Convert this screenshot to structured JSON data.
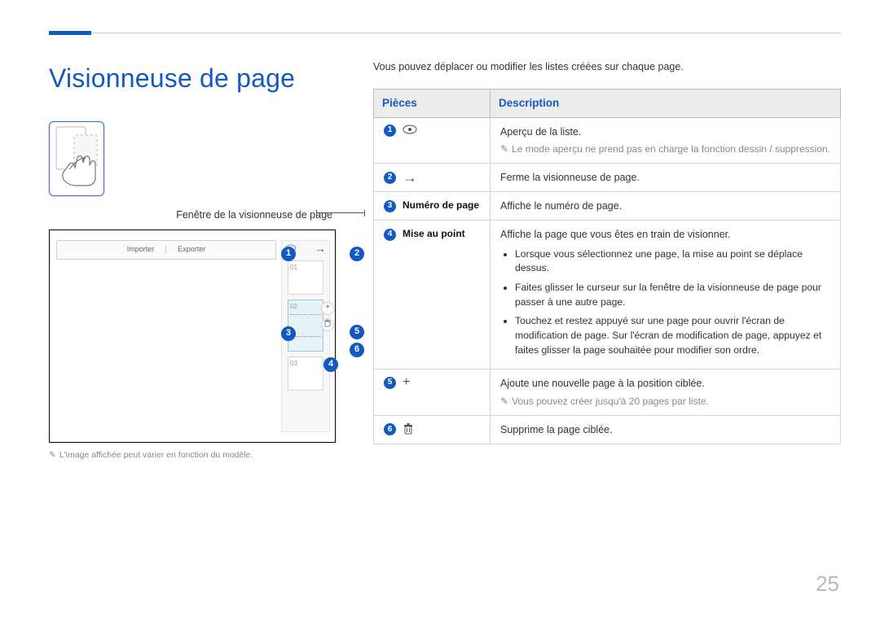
{
  "title": "Visionneuse de page",
  "caption_viewer": "Fenêtre de la visionneuse de page",
  "viewer_toolbar": {
    "import": "Importer",
    "export": "Exporter"
  },
  "viewer_pages": [
    "01",
    "02",
    "03"
  ],
  "viewer_footnote": "L'image affichée peut varier en fonction du modèle.",
  "intro": "Vous pouvez déplacer ou modifier les listes créées sur chaque page.",
  "table": {
    "head_parts": "Pièces",
    "head_desc": "Description",
    "rows": [
      {
        "num": "1",
        "icon": "eye",
        "desc_main": "Aperçu de la liste.",
        "desc_note": "Le mode aperçu ne prend pas en charge la fonction dessin / suppression."
      },
      {
        "num": "2",
        "icon": "arrow-right",
        "desc_main": "Ferme la visionneuse de page."
      },
      {
        "num": "3",
        "label": "Numéro de page",
        "desc_main": "Affiche le numéro de page."
      },
      {
        "num": "4",
        "label": "Mise au point",
        "desc_main": "Affiche la page que vous êtes en train de visionner.",
        "bullets": [
          "Lorsque vous sélectionnez une page, la mise au point se déplace dessus.",
          "Faites glisser le curseur sur la fenêtre de la visionneuse de page pour passer à une autre page.",
          "Touchez et restez appuyé sur une page pour ouvrir l'écran de modification de page. Sur l'écran de modification de page, appuyez et faites glisser la page souhaitée pour modifier son ordre."
        ]
      },
      {
        "num": "5",
        "icon": "plus",
        "desc_main": "Ajoute une nouvelle page à la position ciblée.",
        "desc_note": "Vous pouvez créer jusqu'à 20 pages par liste."
      },
      {
        "num": "6",
        "icon": "trash",
        "desc_main": "Supprime la page ciblée."
      }
    ]
  },
  "page_number": "25"
}
